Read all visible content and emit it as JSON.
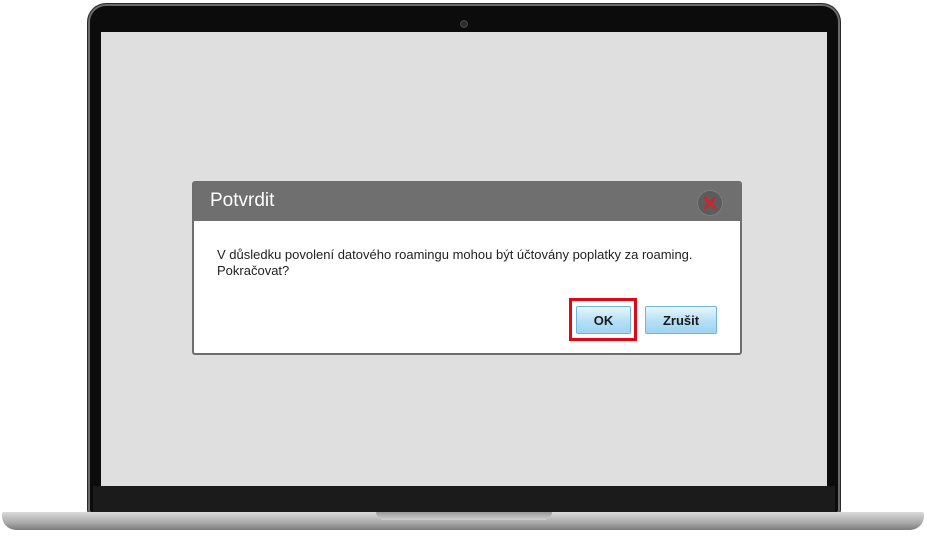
{
  "dialog": {
    "title": "Potvrdit",
    "message_line1": "V důsledku povolení datového roamingu mohou být účtovány poplatky za roaming.",
    "message_line2": "Pokračovat?",
    "ok_label": "OK",
    "cancel_label": "Zrušit",
    "close_icon": "close-icon"
  },
  "colors": {
    "header_bg": "#6f6f6f",
    "highlight": "#e30613",
    "close_x": "#d6202a",
    "button_bg": "#b4dff6"
  }
}
